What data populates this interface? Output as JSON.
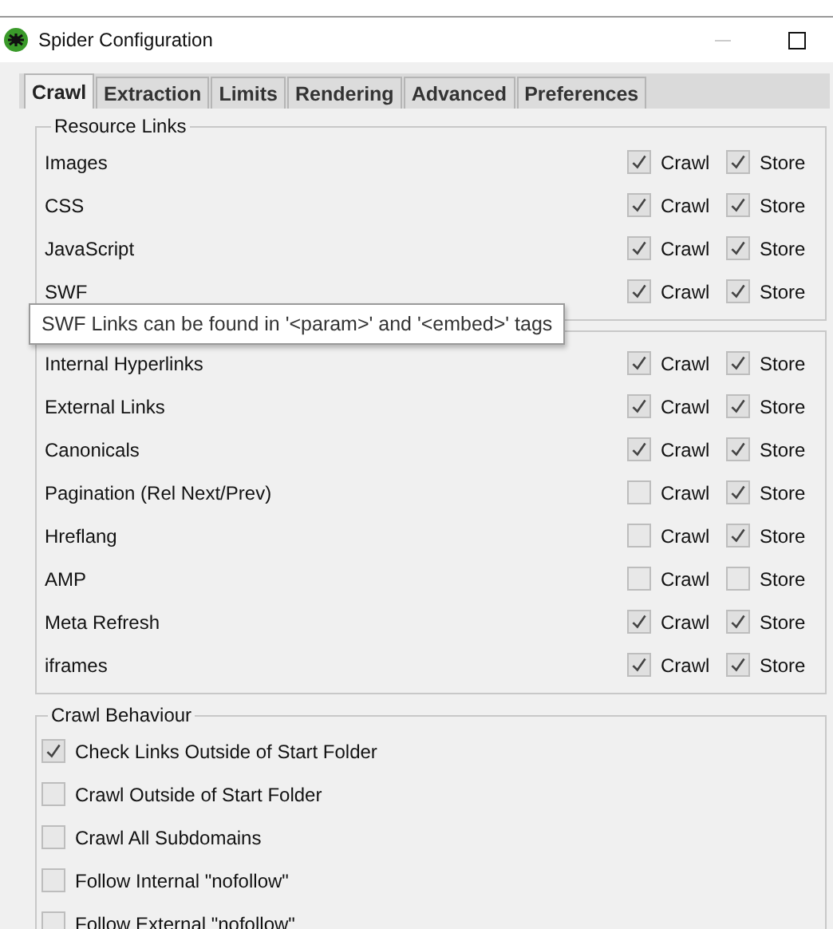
{
  "window": {
    "title": "Spider Configuration"
  },
  "tabs": [
    {
      "label": "Crawl",
      "selected": true
    },
    {
      "label": "Extraction",
      "selected": false
    },
    {
      "label": "Limits",
      "selected": false
    },
    {
      "label": "Rendering",
      "selected": false
    },
    {
      "label": "Advanced",
      "selected": false
    },
    {
      "label": "Preferences",
      "selected": false
    }
  ],
  "groups": [
    {
      "title": "Resource Links",
      "rows": [
        {
          "label": "Images",
          "crawl": {
            "label": "Crawl",
            "checked": true
          },
          "store": {
            "label": "Store",
            "checked": true
          }
        },
        {
          "label": "CSS",
          "crawl": {
            "label": "Crawl",
            "checked": true
          },
          "store": {
            "label": "Store",
            "checked": true
          }
        },
        {
          "label": "JavaScript",
          "crawl": {
            "label": "Crawl",
            "checked": true
          },
          "store": {
            "label": "Store",
            "checked": true
          }
        },
        {
          "label": "SWF",
          "crawl": {
            "label": "Crawl",
            "checked": true
          },
          "store": {
            "label": "Store",
            "checked": true
          }
        }
      ]
    },
    {
      "rows": [
        {
          "label": "Internal Hyperlinks",
          "crawl": {
            "label": "Crawl",
            "checked": true
          },
          "store": {
            "label": "Store",
            "checked": true
          }
        },
        {
          "label": "External Links",
          "crawl": {
            "label": "Crawl",
            "checked": true
          },
          "store": {
            "label": "Store",
            "checked": true
          }
        },
        {
          "label": "Canonicals",
          "crawl": {
            "label": "Crawl",
            "checked": true
          },
          "store": {
            "label": "Store",
            "checked": true
          }
        },
        {
          "label": "Pagination (Rel Next/Prev)",
          "crawl": {
            "label": "Crawl",
            "checked": false
          },
          "store": {
            "label": "Store",
            "checked": true
          }
        },
        {
          "label": "Hreflang",
          "crawl": {
            "label": "Crawl",
            "checked": false
          },
          "store": {
            "label": "Store",
            "checked": true
          }
        },
        {
          "label": "AMP",
          "crawl": {
            "label": "Crawl",
            "checked": false
          },
          "store": {
            "label": "Store",
            "checked": false
          }
        },
        {
          "label": "Meta Refresh",
          "crawl": {
            "label": "Crawl",
            "checked": true
          },
          "store": {
            "label": "Store",
            "checked": true
          }
        },
        {
          "label": "iframes",
          "crawl": {
            "label": "Crawl",
            "checked": true
          },
          "store": {
            "label": "Store",
            "checked": true
          }
        }
      ]
    }
  ],
  "behaviour": {
    "title": "Crawl Behaviour",
    "options": [
      {
        "label": "Check Links Outside of Start Folder",
        "checked": true
      },
      {
        "label": "Crawl Outside of Start Folder",
        "checked": false
      },
      {
        "label": "Crawl All Subdomains",
        "checked": false
      },
      {
        "label": "Follow Internal \"nofollow\"",
        "checked": false
      },
      {
        "label": "Follow External \"nofollow\"",
        "checked": false
      }
    ]
  },
  "tooltip": {
    "text": "SWF Links can be found in '<param>' and '<embed>' tags"
  }
}
